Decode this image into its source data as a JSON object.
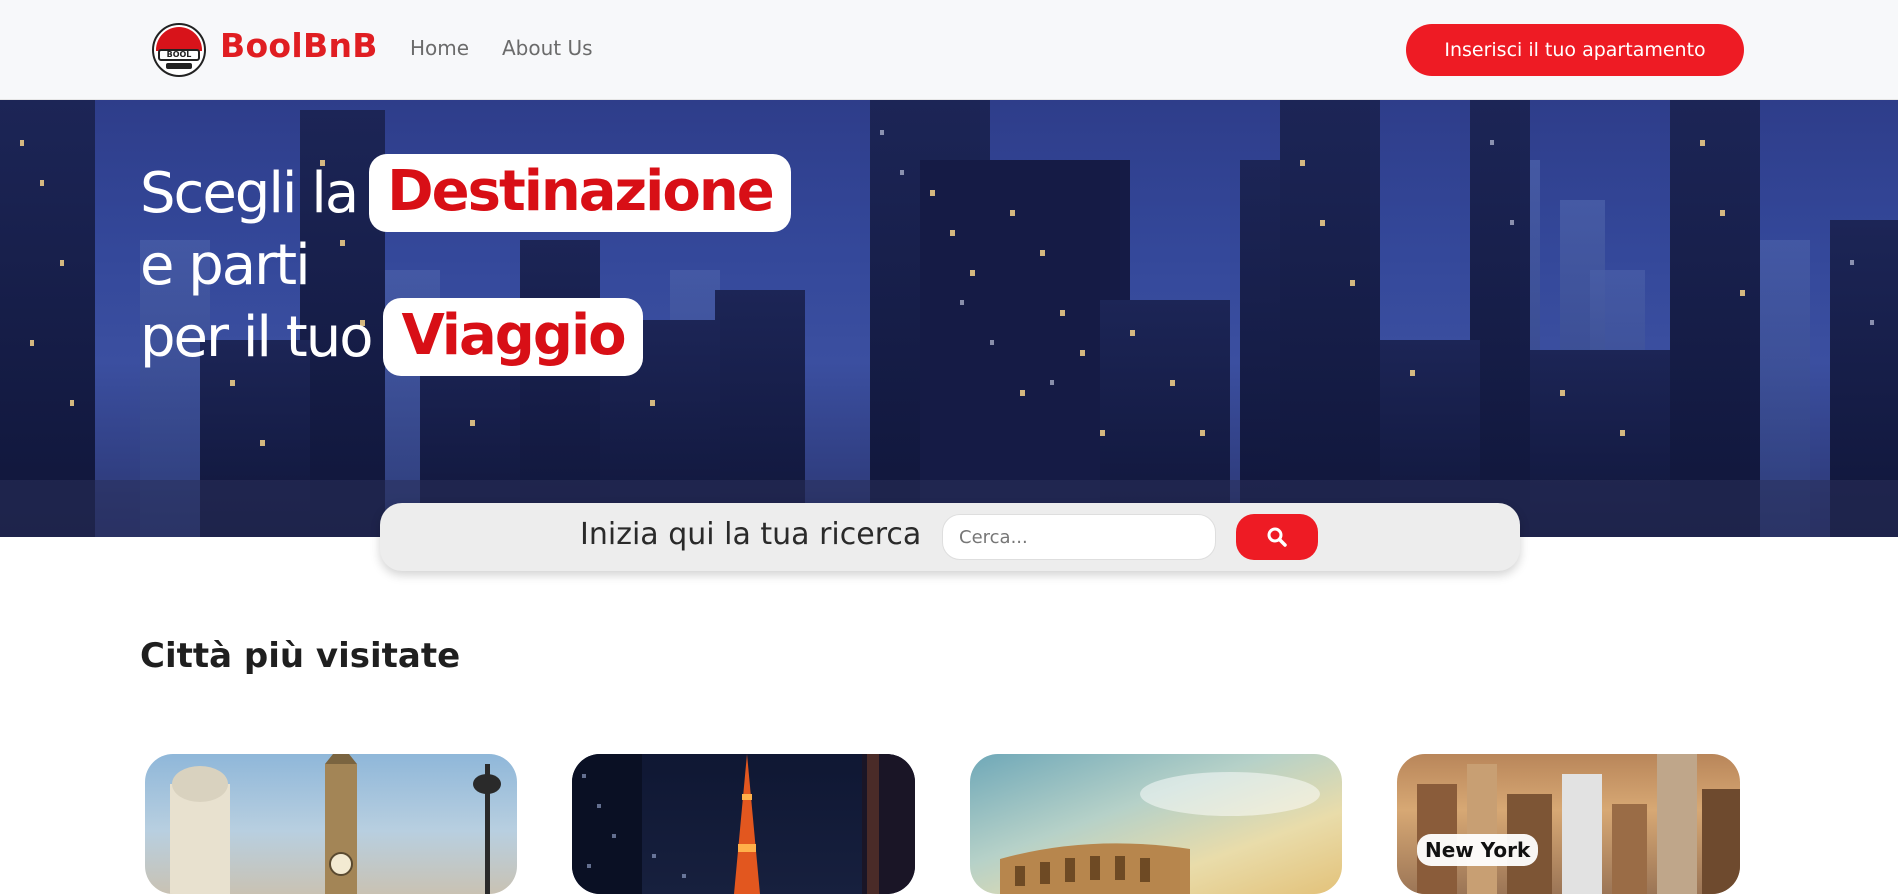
{
  "navbar": {
    "logo_text": "BOOL",
    "brand": "BoolBnB",
    "links": [
      {
        "label": "Home"
      },
      {
        "label": "About Us"
      }
    ],
    "cta_label": "Inserisci il tuo apartamento"
  },
  "hero": {
    "line1_text": "Scegli la",
    "line1_highlight": "Destinazione",
    "line2_text": "e parti",
    "line3_text": "per il tuo",
    "line3_highlight": "Viaggio"
  },
  "search": {
    "label": "Inizia qui la tua ricerca",
    "placeholder": "Cerca...",
    "button_icon": "search-icon"
  },
  "section": {
    "title": "Città più visitate"
  },
  "cities": [
    {
      "name": "",
      "image": "london-big-ben"
    },
    {
      "name": "",
      "image": "tokyo-tower-night"
    },
    {
      "name": "",
      "image": "rome-colosseum"
    },
    {
      "name": "New York",
      "image": "new-york-skyline"
    }
  ],
  "colors": {
    "accent": "#ee1b24",
    "brand_red": "#e01e22",
    "hero_blue": "#34489a",
    "navbar_bg": "#f7f8fa"
  }
}
